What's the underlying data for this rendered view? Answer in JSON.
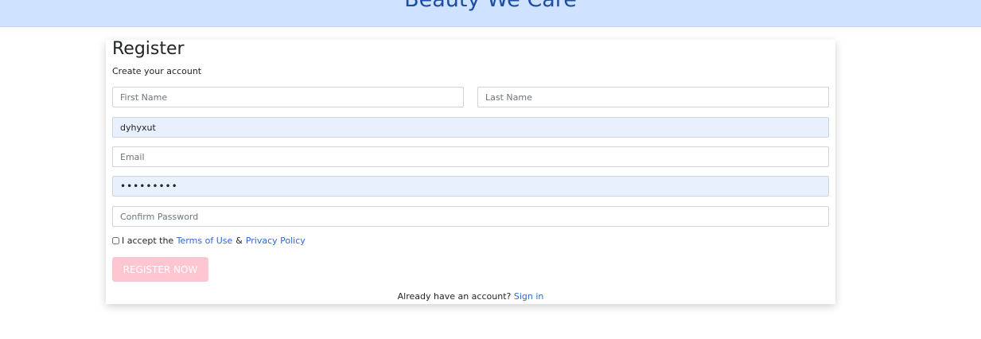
{
  "header": {
    "brand": "Beauty We Care"
  },
  "form": {
    "title": "Register",
    "subtitle": "Create your account",
    "first_name": {
      "placeholder": "First Name",
      "value": ""
    },
    "last_name": {
      "placeholder": "Last Name",
      "value": ""
    },
    "username": {
      "placeholder": "",
      "value": "dyhyxut"
    },
    "email": {
      "placeholder": "Email",
      "value": ""
    },
    "password": {
      "placeholder": "",
      "value": "123456789"
    },
    "confirm_password": {
      "placeholder": "Confirm Password",
      "value": ""
    },
    "terms": {
      "prefix": "I accept the",
      "terms_link": "Terms of Use",
      "ampersand": "&",
      "privacy_link": "Privacy Policy",
      "checked": false
    },
    "register_button": "REGISTER NOW",
    "signin": {
      "prompt": "Already have an account?",
      "link": "Sign in"
    }
  },
  "colors": {
    "header_bg": "#cfe2ff",
    "brand_text": "#1b4fa3",
    "link": "#2f68d8",
    "autofill_bg": "#e8f0fe",
    "button_bg": "#ffc5d0"
  }
}
